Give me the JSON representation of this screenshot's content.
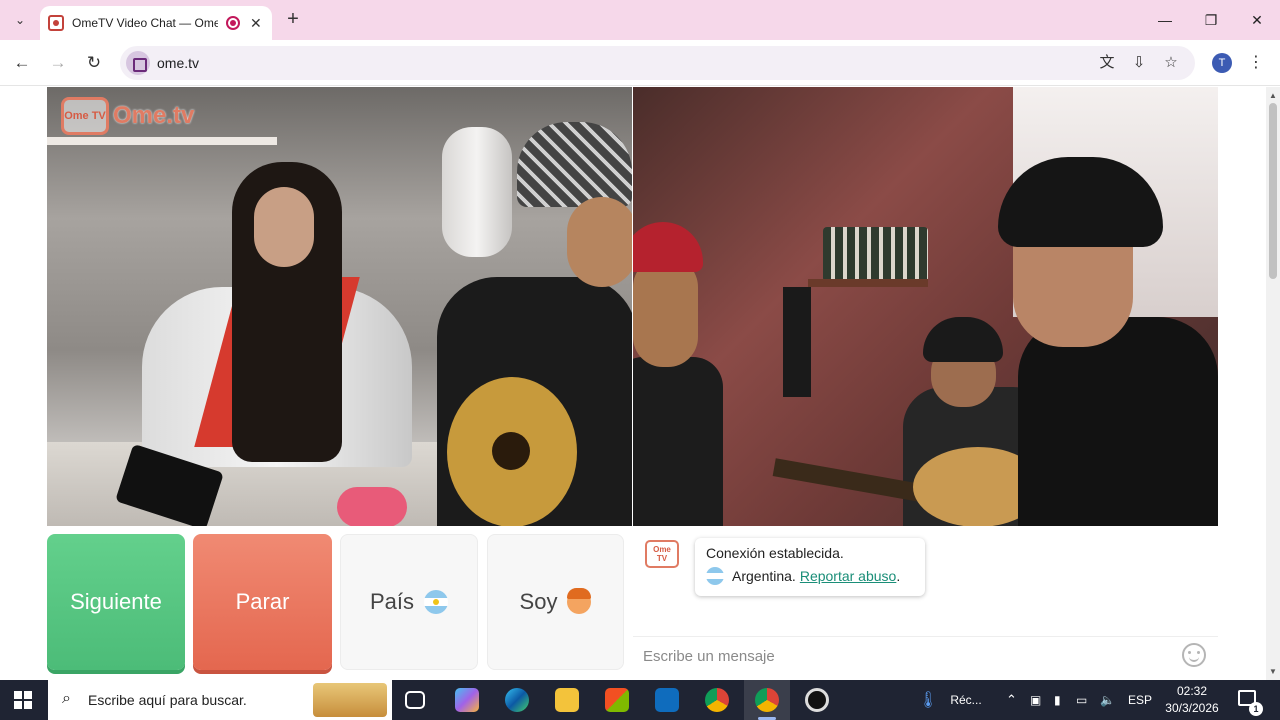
{
  "browser": {
    "tab": {
      "title": "OmeTV Video Chat — Ome",
      "close": "✕"
    },
    "new_tab": "+",
    "window_controls": {
      "minimize": "—",
      "maximize": "❐",
      "close": "✕"
    },
    "address": "ome.tv",
    "profile_initial": "T",
    "nav": {
      "back": "←",
      "forward": "→",
      "reload": "↻"
    }
  },
  "page": {
    "logo": {
      "badge": "Ome TV",
      "wordmark": "Ome.tv"
    },
    "buttons": {
      "next": "Siguiente",
      "stop": "Parar",
      "country": "País",
      "gender": "Soy"
    },
    "chat": {
      "logo_badge": "Ome TV",
      "status": "Conexión establecida.",
      "country": "Argentina.",
      "report": "Reportar abuso",
      "report_suffix": ".",
      "input_placeholder": "Escribe un mensaje"
    },
    "colors": {
      "next": "#4cbc78",
      "stop": "#e4674f",
      "link": "#1a8e78",
      "brand": "#e07b63"
    }
  },
  "taskbar": {
    "search_placeholder": "Escribe aquí para buscar.",
    "tray": {
      "weather_label": "Réc...",
      "language": "ESP"
    },
    "clock": {
      "time": "02:32",
      "date": "30/3/2026"
    },
    "notifications_count": "1"
  }
}
